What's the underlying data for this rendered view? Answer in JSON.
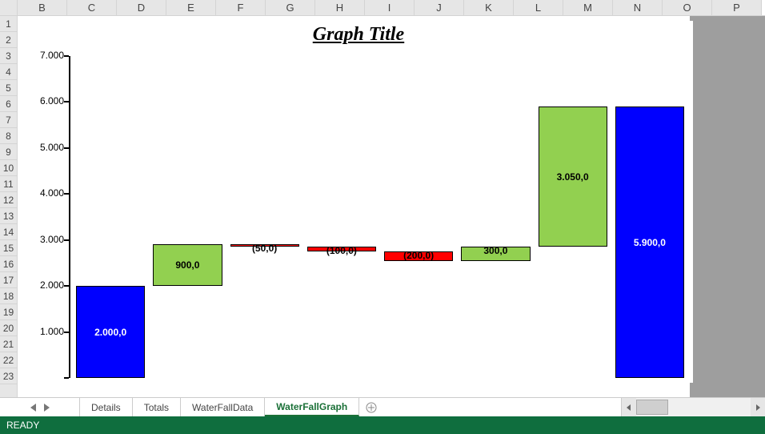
{
  "columns": [
    "B",
    "C",
    "D",
    "E",
    "F",
    "G",
    "H",
    "I",
    "J",
    "K",
    "L",
    "M",
    "N",
    "O",
    "P"
  ],
  "rows": [
    "1",
    "2",
    "3",
    "4",
    "5",
    "6",
    "7",
    "8",
    "9",
    "10",
    "11",
    "12",
    "13",
    "14",
    "15",
    "16",
    "17",
    "18",
    "19",
    "20",
    "21",
    "22",
    "23"
  ],
  "tabs": {
    "items": [
      "Details",
      "Totals",
      "WaterFallData",
      "WaterFallGraph"
    ],
    "active_index": 3,
    "add_hint": "+"
  },
  "status": {
    "ready": "READY"
  },
  "chart": {
    "title": "Graph Title"
  },
  "chart_data": {
    "type": "bar",
    "subtype": "waterfall",
    "title": "Graph Title",
    "xlabel": "",
    "ylabel": "",
    "ylim": [
      0,
      7000
    ],
    "yticks": [
      0,
      1000,
      2000,
      3000,
      4000,
      5000,
      6000,
      7000
    ],
    "ytick_labels": [
      "",
      "1.000",
      "2.000",
      "3.000",
      "4.000",
      "5.000",
      "6.000",
      "7.000"
    ],
    "bars": [
      {
        "kind": "total",
        "base": 0,
        "value": 2000,
        "label": "2.000,0",
        "color": "#0000ff",
        "text_color": "#ffffff"
      },
      {
        "kind": "increase",
        "base": 2000,
        "value": 900,
        "label": "900,0",
        "color": "#92d050",
        "text_color": "#000000"
      },
      {
        "kind": "decrease",
        "base": 2900,
        "value": -50,
        "label": "(50,0)",
        "color": "#ff0000",
        "text_color": "#000000"
      },
      {
        "kind": "decrease",
        "base": 2850,
        "value": -100,
        "label": "(100,0)",
        "color": "#ff0000",
        "text_color": "#000000"
      },
      {
        "kind": "decrease",
        "base": 2750,
        "value": -200,
        "label": "(200,0)",
        "color": "#ff0000",
        "text_color": "#000000"
      },
      {
        "kind": "increase",
        "base": 2550,
        "value": 300,
        "label": "300,0",
        "color": "#92d050",
        "text_color": "#000000"
      },
      {
        "kind": "increase",
        "base": 2850,
        "value": 3050,
        "label": "3.050,0",
        "color": "#92d050",
        "text_color": "#000000"
      },
      {
        "kind": "total",
        "base": 0,
        "value": 5900,
        "label": "5.900,0",
        "color": "#0000ff",
        "text_color": "#ffffff"
      }
    ]
  }
}
